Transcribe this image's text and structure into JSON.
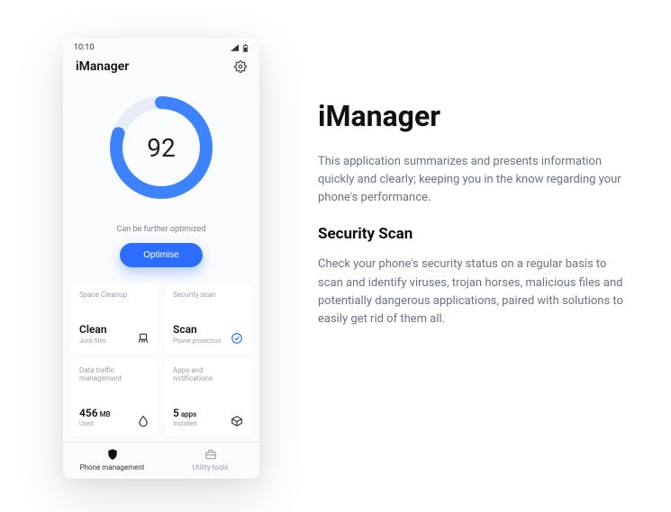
{
  "statusbar": {
    "time": "10:10"
  },
  "header": {
    "title": "iManager"
  },
  "gauge": {
    "score": "92",
    "percent": 80,
    "hint": "Can be further optimized",
    "button": "Optimise"
  },
  "cards": [
    {
      "top": "Space Cleanup",
      "main": "Clean",
      "sub": "Junk files",
      "icon": "broom"
    },
    {
      "top": "Security scan",
      "main": "Scan",
      "sub": "Phone protection",
      "icon": "check-circle"
    },
    {
      "top": "Data traffic management",
      "main": "456",
      "unit": "MB",
      "sub": "Used",
      "icon": "drop"
    },
    {
      "top": "Apps and notifications",
      "main": "5",
      "unit": "apps",
      "sub": "Installed",
      "icon": "cube"
    }
  ],
  "tabs": [
    {
      "label": "Phone management",
      "icon": "shield",
      "active": true
    },
    {
      "label": "Utility tools",
      "icon": "toolbox",
      "active": false
    }
  ],
  "copy": {
    "title": "iManager",
    "desc": "This application summarizes and presents information quickly and clearly; keeping you in the know regarding your phone's performance.",
    "subhead": "Security Scan",
    "subdesc": "Check your phone's security status on a regular basis to scan and identify viruses, trojan horses, malicious files and potentially dangerous applications, paired with solutions to easily get rid of them all."
  }
}
